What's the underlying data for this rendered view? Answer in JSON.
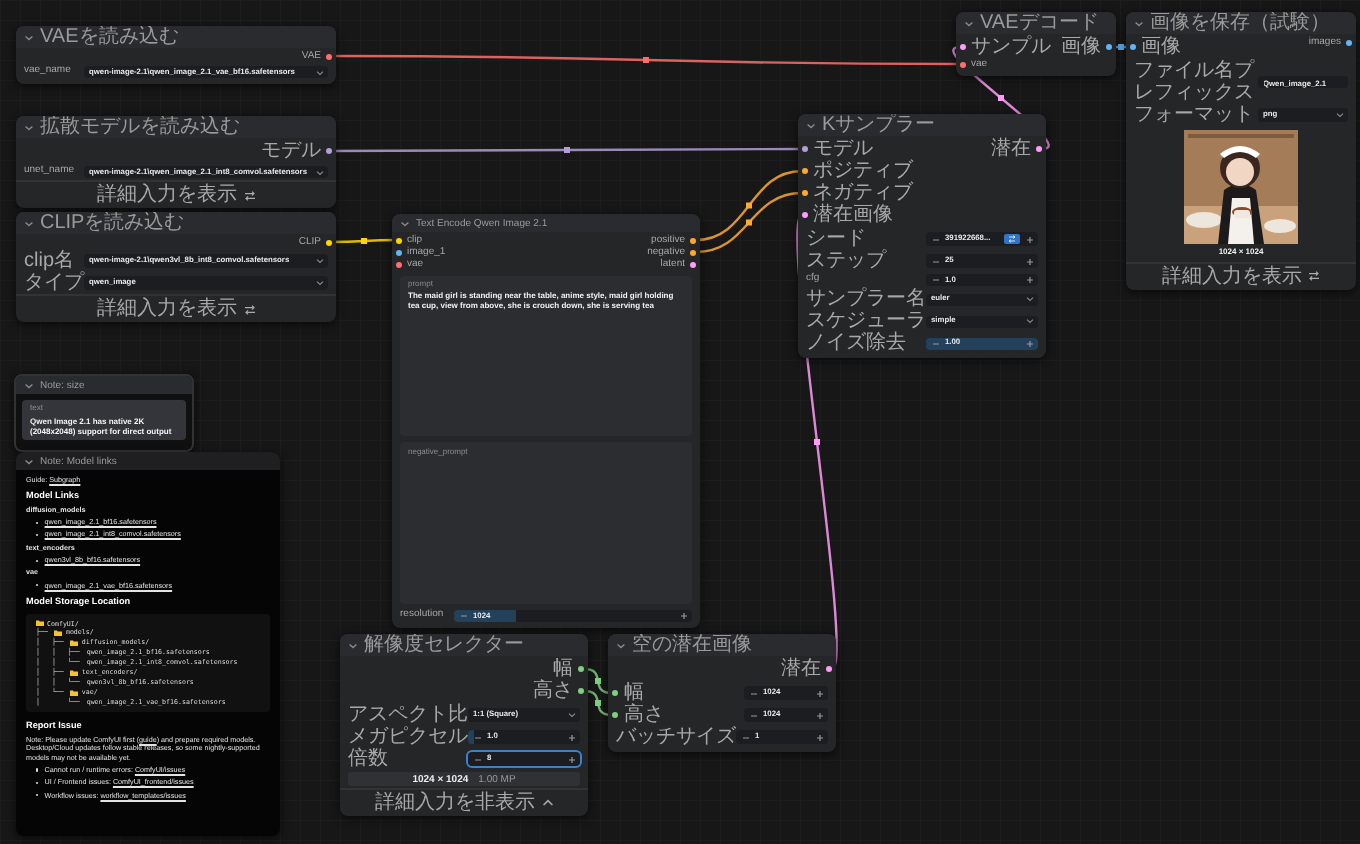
{
  "nodes": [
    {
      "kind": "node",
      "title": "VAEを読み込む",
      "outputs": [
        {
          "name": "VAE",
          "color": "#ff6e6e"
        }
      ],
      "widgets": [
        {
          "kind": "combo",
          "label": "vae_name",
          "value": "qwen-image-2.1\\qwen_image_2.1_vae_bf16.safetensors"
        }
      ]
    },
    {
      "kind": "node",
      "title": "拡散モデルを読み込む",
      "outputs": [
        {
          "name": "モデル",
          "color": "#b39ddb"
        }
      ],
      "widgets": [
        {
          "kind": "combo",
          "label": "unet_name",
          "value": "qwen-image-2.1\\qwen_image_2.1_int8_comvol.safetensors"
        }
      ],
      "footer": {
        "text": "詳細入力を表示",
        "expanded": false
      }
    },
    {
      "kind": "node",
      "title": "CLIPを読み込む",
      "outputs": [
        {
          "name": "CLIP",
          "color": "#ffd500"
        }
      ],
      "widgets": [
        {
          "kind": "combo",
          "label": "clip名",
          "value": "qwen-image-2.1\\qwen3vl_8b_int8_comvol.safetensors"
        },
        {
          "kind": "combo",
          "label": "タイプ",
          "value": "qwen_image"
        }
      ],
      "footer": {
        "text": "詳細入力を表示",
        "expanded": false
      }
    },
    {
      "kind": "node",
      "title": "Text Encode Qwen Image 2.1",
      "inputs": [
        {
          "name": "clip",
          "color": "#ffd500"
        },
        {
          "name": "image_1",
          "color": "#64b5f6"
        },
        {
          "name": "vae",
          "color": "#ff6e6e"
        }
      ],
      "outputs": [
        {
          "name": "positive",
          "color": "#ffa931"
        },
        {
          "name": "negative",
          "color": "#ffa931"
        },
        {
          "name": "latent",
          "color": "#ff9cf9"
        }
      ],
      "widgets": [
        {
          "kind": "textarea",
          "label": "prompt",
          "value": "The maid girl is standing near the table, anime style, maid girl holding tea cup, view from above, she is crouch down, she is serving tea"
        },
        {
          "kind": "textarea",
          "placeholder": "negative_prompt"
        },
        {
          "kind": "number",
          "label": "resolution",
          "value": "1024",
          "level": 0.26,
          "focused": false
        }
      ]
    },
    {
      "kind": "node",
      "title": "Kサンプラー",
      "inputs": [
        {
          "name": "モデル",
          "color": "#b39ddb"
        },
        {
          "name": "ポジティブ",
          "color": "#ffa931"
        },
        {
          "name": "ネガティブ",
          "color": "#ffa931"
        },
        {
          "name": "潜在画像",
          "color": "#ff9cf9"
        }
      ],
      "outputs": [
        {
          "name": "潜在",
          "color": "#ff9cf9"
        }
      ],
      "widgets": [
        {
          "kind": "seed",
          "label": "シード",
          "value": "391922668...",
          "focused": false
        },
        {
          "kind": "number",
          "label": "ステップ",
          "value": "25",
          "focused": false
        },
        {
          "kind": "number",
          "label": "cfg",
          "value": "1.0",
          "focused": false
        },
        {
          "kind": "combo",
          "label": "サンプラー名",
          "value": "euler"
        },
        {
          "kind": "combo",
          "label": "スケジューラ",
          "value": "simple"
        },
        {
          "kind": "number",
          "label": "ノイズ除去",
          "value": "1.00",
          "level": 1,
          "focused": false
        }
      ]
    },
    {
      "kind": "node",
      "title": "VAEデコード",
      "inputs": [
        {
          "name": "サンプル",
          "color": "#ff9cf9"
        },
        {
          "name": "vae",
          "color": "#ff6e6e"
        }
      ],
      "outputs": [
        {
          "name": "画像",
          "color": "#64b5f6"
        }
      ]
    },
    {
      "kind": "node",
      "title": "画像を保存（試験）",
      "inputs": [
        {
          "name": "画像",
          "color": "#64b5f6"
        }
      ],
      "outputs": [
        {
          "name": "images",
          "color": "#64b5f6"
        }
      ],
      "widgets": [
        {
          "kind": "text",
          "label": "ファイル名プレフィックス",
          "value": "Qwen_image_2.1"
        },
        {
          "kind": "combo",
          "label": "フォーマット",
          "value": "png"
        },
        {
          "caption": "1024 × 1024"
        }
      ],
      "footer": {
        "text": "詳細入力を表示",
        "expanded": false
      }
    },
    {
      "kind": "note",
      "title": "Note: size",
      "widgets": [
        {
          "kind": "textarea",
          "label": "text",
          "value": "Qwen Image 2.1 has native 2K (2048x2048) support for direct output"
        }
      ]
    },
    {
      "kind": "markdown",
      "title": "Note: Model links",
      "blocks": [
        {
          "kind": "para",
          "parts": [
            {
              "text": "Guide: "
            },
            {
              "text": "Subgraph",
              "link": true
            }
          ]
        },
        {
          "kind": "heading",
          "parts": [
            {
              "text": "Model Links"
            }
          ]
        },
        {
          "kind": "label",
          "parts": [
            {
              "text": "diffusion_models"
            }
          ]
        },
        {
          "kind": "item",
          "parts": [
            {
              "text": "qwen_image_2.1_bf16.safetensors",
              "link": true
            }
          ]
        },
        {
          "kind": "item",
          "parts": [
            {
              "text": "qwen_image_2.1_int8_comvol.safetensors",
              "link": true
            }
          ]
        },
        {
          "kind": "label",
          "parts": [
            {
              "text": "text_encoders"
            }
          ]
        },
        {
          "kind": "item",
          "parts": [
            {
              "text": "qwen3vl_8b_bf16.safetensors",
              "link": true
            }
          ]
        },
        {
          "kind": "label",
          "parts": [
            {
              "text": "vae"
            }
          ]
        },
        {
          "kind": "item",
          "parts": [
            {
              "text": "qwen_image_2.1_vae_bf16.safetensors",
              "link": true
            }
          ]
        },
        {
          "kind": "heading",
          "parts": [
            {
              "text": "Model Storage Location"
            }
          ]
        },
        {
          "kind": "code",
          "lines": [
            {
              "folder": true,
              "text": "ComfyUI/"
            },
            {
              "lead": "├── ",
              "folder": true,
              "text": "models/"
            },
            {
              "lead": "│   ├── ",
              "folder": true,
              "text": "diffusion_models/"
            },
            {
              "lead": "│   │   ├── ",
              "folder": false,
              "text": "qwen_image_2.1_bf16.safetensors"
            },
            {
              "lead": "│   │   └── ",
              "folder": false,
              "text": "qwen_image_2.1_int8_comvol.safetensors"
            },
            {
              "lead": "│   ├── ",
              "folder": true,
              "text": "text_encoders/"
            },
            {
              "lead": "│   │   └── ",
              "folder": false,
              "text": "qwen3vl_8b_bf16.safetensors"
            },
            {
              "lead": "│   └── ",
              "folder": true,
              "text": "vae/"
            },
            {
              "lead": "│       └── ",
              "folder": false,
              "text": "qwen_image_2.1_vae_bf16.safetensors"
            }
          ]
        },
        {
          "kind": "heading",
          "parts": [
            {
              "text": "Report Issue"
            }
          ]
        },
        {
          "kind": "para",
          "parts": [
            {
              "text": "Note: Please update ComfyUI first ("
            },
            {
              "text": "guide",
              "link": true
            },
            {
              "text": ") and prepare required models. Desktop/Cloud updates follow stable releases, so some nightly-supported models may not be available yet."
            }
          ]
        },
        {
          "kind": "item",
          "parts": [
            {
              "text": "Cannot run / runtime errors: "
            },
            {
              "text": "ComfyUI/issues",
              "link": true
            }
          ]
        },
        {
          "kind": "item",
          "parts": [
            {
              "text": "UI / Frontend issues: "
            },
            {
              "text": "ComfyUI_frontend/issues",
              "link": true
            }
          ]
        },
        {
          "kind": "item",
          "parts": [
            {
              "text": "Workflow issues: "
            },
            {
              "text": "workflow_templates/issues",
              "link": true
            }
          ]
        }
      ]
    },
    {
      "kind": "node",
      "title": "解像度セレクター",
      "outputs": [
        {
          "name": "幅",
          "color": "#7fcf7f"
        },
        {
          "name": "高さ",
          "color": "#7fcf7f"
        }
      ],
      "widgets": [
        {
          "kind": "combo",
          "label": "アスペクト比",
          "value": "1:1 (Square)"
        },
        {
          "kind": "number",
          "label": "メガピクセル",
          "value": "1.0",
          "level": 0.05,
          "focused": false
        },
        {
          "kind": "number",
          "label": "倍数",
          "value": "8",
          "focused": true
        },
        {
          "kind": "info",
          "value": "1024 × 1024",
          "detail": "1.00 MP"
        }
      ],
      "footer": {
        "text": "詳細入力を非表示",
        "expanded": true
      }
    },
    {
      "kind": "node",
      "title": "空の潜在画像",
      "outputs": [
        {
          "name": "潜在",
          "color": "#ff9cf9"
        }
      ],
      "widgets": [
        {
          "kind": "number",
          "label": "幅",
          "value": "1024",
          "focused": false,
          "color": "#7fcf7f"
        },
        {
          "kind": "number",
          "label": "高さ",
          "value": "1024",
          "focused": false,
          "color": "#7fcf7f"
        },
        {
          "kind": "number",
          "label": "バッチサイズ",
          "value": "1",
          "focused": false
        }
      ]
    }
  ]
}
